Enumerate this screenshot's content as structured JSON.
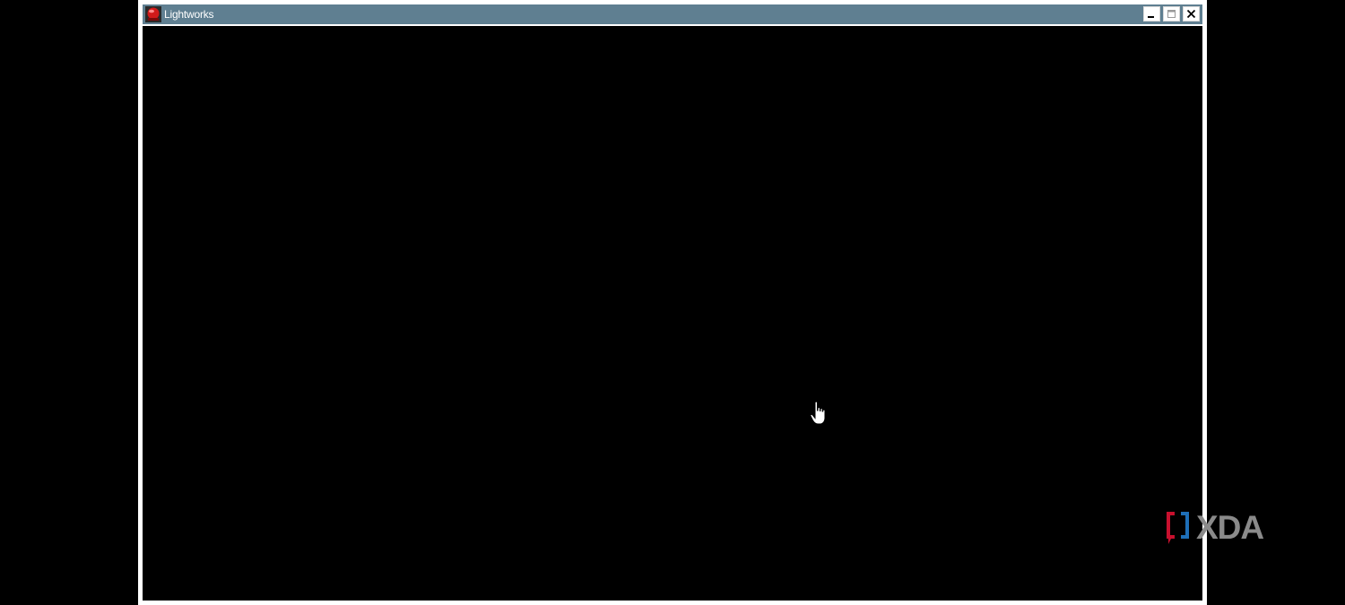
{
  "window": {
    "title": "Lightworks",
    "icon": "lightworks-app-icon",
    "controls": {
      "minimize_icon": "minimize-icon",
      "maximize_icon": "maximize-icon",
      "close_icon": "close-icon"
    }
  },
  "cursor": {
    "icon": "hand-pointer-icon"
  },
  "watermark": {
    "text": "XDA",
    "logo_icon": "xda-bracket-icon"
  },
  "colors": {
    "titlebar": "#5f7f91",
    "frame": "#ffffff",
    "client_background": "#000000",
    "watermark_text": "#8a8a8a",
    "watermark_red": "#c8102e",
    "watermark_blue": "#1e6fb8"
  }
}
